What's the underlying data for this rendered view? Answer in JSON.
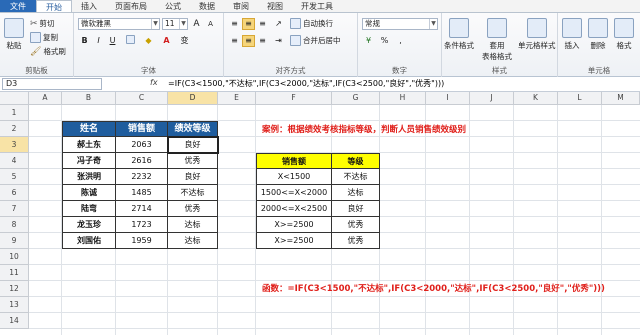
{
  "tabs": [
    "文件",
    "开始",
    "插入",
    "页面布局",
    "公式",
    "数据",
    "审阅",
    "视图",
    "开发工具"
  ],
  "ribbon": {
    "clipboard": {
      "cut": "剪切",
      "copy": "复制",
      "format_painter": "格式刷",
      "paste": "粘贴",
      "label": "剪贴板"
    },
    "font": {
      "name": "微软雅黑",
      "size": "11",
      "bold": "B",
      "italic": "I",
      "underline": "U",
      "grow": "A",
      "shrink": "A",
      "wen": "变",
      "label": "字体"
    },
    "alignment": {
      "wrap": "自动换行",
      "merge": "合并后居中",
      "label": "对齐方式"
    },
    "number": {
      "format": "常规",
      "percent": "%",
      "comma": ",",
      "label": "数字"
    },
    "styles": {
      "conditional": "条件格式",
      "table_format_1": "套用",
      "table_format_2": "表格格式",
      "cell_styles": "单元格样式",
      "label": "样式"
    },
    "cells": {
      "insert": "插入",
      "delete": "删除",
      "format": "格式",
      "label": "单元格"
    }
  },
  "formula_bar": {
    "name_box": "D3",
    "fx": "fx",
    "formula": "=IF(C3<1500,\"不达标\",IF(C3<2000,\"达标\",IF(C3<2500,\"良好\",\"优秀\")))"
  },
  "columns": [
    "A",
    "B",
    "C",
    "D",
    "E",
    "F",
    "G",
    "H",
    "I",
    "J",
    "K",
    "L",
    "M"
  ],
  "rows": [
    "1",
    "2",
    "3",
    "4",
    "5",
    "6",
    "7",
    "8",
    "9",
    "10",
    "11",
    "12",
    "13",
    "14"
  ],
  "main_table": {
    "headers": [
      "姓名",
      "销售额",
      "绩效等级"
    ],
    "rows": [
      [
        "郝土东",
        "2063",
        "良好"
      ],
      [
        "冯子奇",
        "2616",
        "优秀"
      ],
      [
        "张洪明",
        "2232",
        "良好"
      ],
      [
        "陈诚",
        "1485",
        "不达标"
      ],
      [
        "陆弯",
        "2714",
        "优秀"
      ],
      [
        "龙玉珍",
        "1723",
        "达标"
      ],
      [
        "刘国佑",
        "1959",
        "达标"
      ]
    ]
  },
  "case_note": "案例：根据绩效考核指标等级，判断人员销售绩效级别",
  "criteria_table": {
    "headers": [
      "销售额",
      "等级"
    ],
    "rows": [
      [
        "X<1500",
        "不达标"
      ],
      [
        "1500<=X<2000",
        "达标"
      ],
      [
        "2000<=X<2500",
        "良好"
      ],
      [
        "X>=2500",
        "优秀"
      ],
      [
        "X>=2500",
        "优秀"
      ]
    ]
  },
  "function_note": "函数：=IF(C3<1500,\"不达标\",IF(C3<2000,\"达标\",IF(C3<2500,\"良好\",\"优秀\")))",
  "colors": {
    "header_blue": "#1f5d9e",
    "header_yellow": "#ffff00",
    "note_red": "#e0201b",
    "file_tab": "#2a6ab7"
  }
}
